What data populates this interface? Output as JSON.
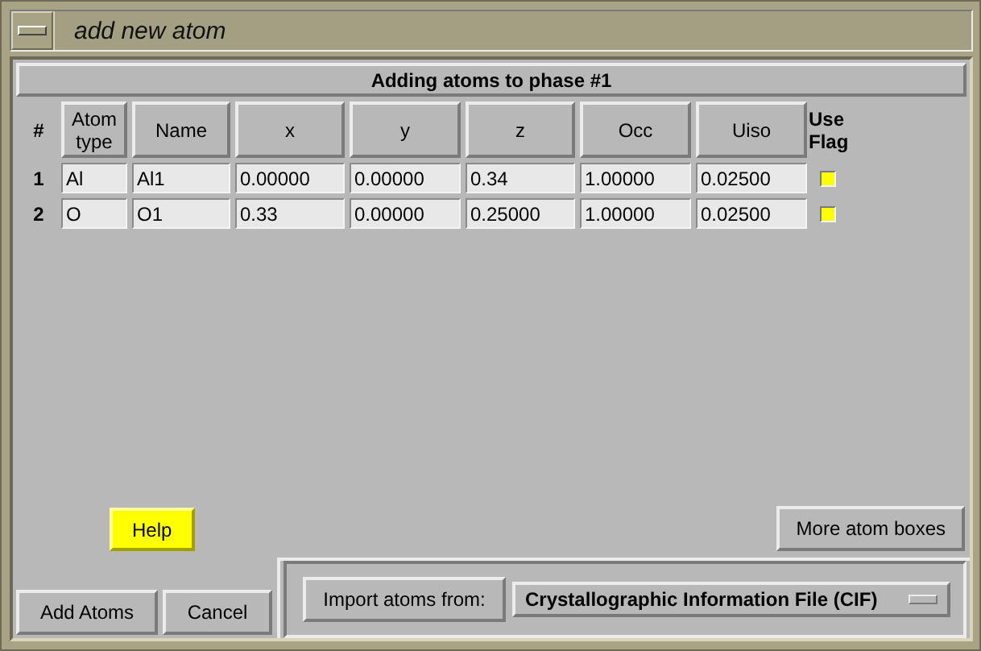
{
  "window": {
    "title": "add new atom"
  },
  "heading": "Adding atoms to phase #1",
  "table": {
    "number_header": "#",
    "columns": [
      "Atom type",
      "Name",
      "x",
      "y",
      "z",
      "Occ",
      "Uiso"
    ],
    "flag_header": "Use Flag",
    "rows": [
      {
        "number": "1",
        "values": [
          "Al",
          "Al1",
          "0.00000",
          "0.00000",
          "0.34",
          "1.00000",
          "0.02500"
        ],
        "use_flag": true
      },
      {
        "number": "2",
        "values": [
          "O",
          "O1",
          "0.33",
          "0.00000",
          "0.25000",
          "1.00000",
          "0.02500"
        ],
        "use_flag": true
      }
    ]
  },
  "help_button": "Help",
  "more_button": "More atom boxes",
  "add_button": "Add Atoms",
  "cancel_button": "Cancel",
  "import": {
    "label": "Import atoms from:",
    "format": "Crystallographic Information File (CIF)"
  }
}
